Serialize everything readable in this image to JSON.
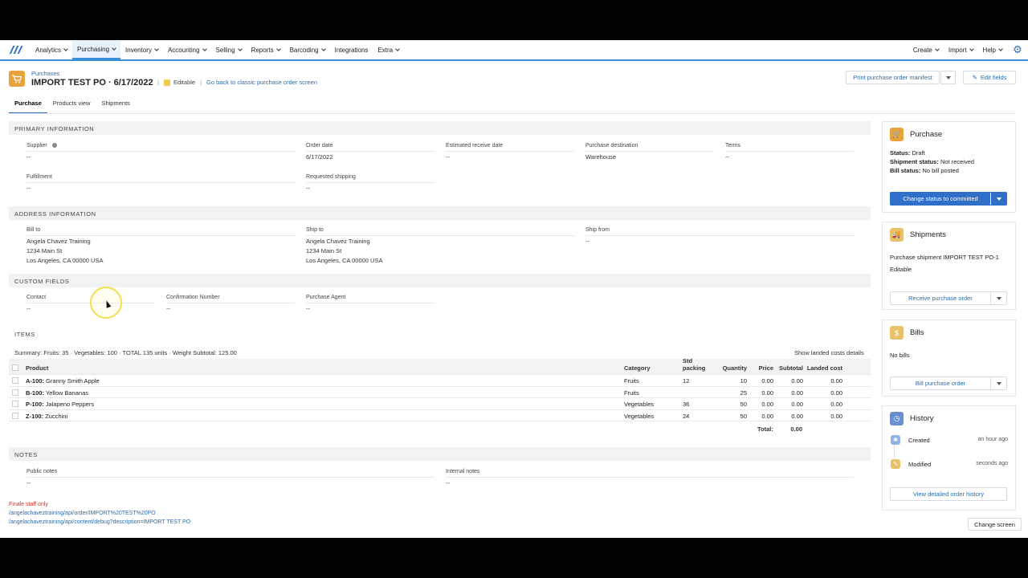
{
  "nav": {
    "items": [
      "Analytics",
      "Purchasing",
      "Inventory",
      "Accounting",
      "Selling",
      "Reports",
      "Barcoding",
      "Integrations",
      "Extra"
    ],
    "right_items": [
      "Create",
      "Import",
      "Help"
    ]
  },
  "header": {
    "breadcrumb": "Purchases",
    "title": "IMPORT TEST PO · 6/17/2022",
    "editable": "Editable",
    "classic_link": "Go back to classic purchase order screen",
    "print_manifest": "Print purchase order manifest",
    "edit_fields": "Edit fields"
  },
  "tabs": [
    "Purchase",
    "Products view",
    "Shipments"
  ],
  "primary": {
    "title": "PRIMARY INFORMATION",
    "supplier_label": "Supplier",
    "supplier_value": "--",
    "order_date_label": "Order date",
    "order_date_value": "6/17/2022",
    "est_receive_label": "Estimated receive date",
    "est_receive_value": "--",
    "destination_label": "Purchase destination",
    "destination_value": "Warehouse",
    "terms_label": "Terms",
    "terms_value": "--",
    "fulfillment_label": "Fulfillment",
    "fulfillment_value": "--",
    "req_shipping_label": "Requested shipping",
    "req_shipping_value": "--"
  },
  "address": {
    "title": "ADDRESS INFORMATION",
    "bill_to_label": "Bill to",
    "bill_to_lines": [
      "Angela Chavez Training",
      "1234 Main St",
      "Los Angeles, CA 00000 USA"
    ],
    "ship_to_label": "Ship to",
    "ship_to_lines": [
      "Angela Chavez Training",
      "1234 Main St",
      "Los Angeles, CA 00000 USA"
    ],
    "ship_from_label": "Ship from",
    "ship_from_value": "--"
  },
  "custom": {
    "title": "CUSTOM FIELDS",
    "contact_label": "Contact",
    "contact_value": "--",
    "confirmation_label": "Confirmation Number",
    "confirmation_value": "--",
    "agent_label": "Purchase Agent",
    "agent_value": "--"
  },
  "items": {
    "title": "ITEMS",
    "summary": "Summary: Fruits: 35 · Vegetables: 100 · TOTAL 135 units · Weight Subtotal: 125.00",
    "landed_link": "Show landed costs details",
    "columns": [
      "Product",
      "Category",
      "Std packing",
      "Quantity",
      "Price",
      "Subtotal",
      "Landed cost"
    ],
    "rows": [
      {
        "sku": "A-100:",
        "name": "Granny Smith Apple",
        "category": "Fruits",
        "std": "12",
        "qty": "10",
        "price": "0.00",
        "subtotal": "0.00",
        "landed": "0.00"
      },
      {
        "sku": "B-100:",
        "name": "Yellow Bananas",
        "category": "Fruits",
        "std": "",
        "qty": "25",
        "price": "0.00",
        "subtotal": "0.00",
        "landed": "0.00"
      },
      {
        "sku": "P-100:",
        "name": "Jalapeno Peppers",
        "category": "Vegetables",
        "std": "36",
        "qty": "50",
        "price": "0.00",
        "subtotal": "0.00",
        "landed": "0.00"
      },
      {
        "sku": "Z-100:",
        "name": "Zucchini",
        "category": "Vegetables",
        "std": "24",
        "qty": "50",
        "price": "0.00",
        "subtotal": "0.00",
        "landed": "0.00"
      }
    ],
    "total_label": "Total:",
    "total_value": "0.00"
  },
  "notes": {
    "title": "NOTES",
    "public_label": "Public notes",
    "public_value": "--",
    "internal_label": "Internal notes",
    "internal_value": "--"
  },
  "footer": {
    "staff": "Finale staff only",
    "link1": "/angelachaveztraining/api/order/IMPORT%20TEST%20PO",
    "link2": "/angelachaveztraining/api/content/debug?description=IMPORT TEST PO",
    "change_screen": "Change screen"
  },
  "sidebar": {
    "purchase": {
      "title": "Purchase",
      "status_label": "Status:",
      "status_value": "Draft",
      "shipment_label": "Shipment status:",
      "shipment_value": "Not received",
      "bill_label": "Bill status:",
      "bill_value": "No bill posted",
      "button": "Change status to committed"
    },
    "shipments": {
      "title": "Shipments",
      "link": "Purchase shipment IMPORT TEST PO-1",
      "status": "Editable",
      "button": "Receive purchase order"
    },
    "bills": {
      "title": "Bills",
      "text": "No bills",
      "button": "Bill purchase order"
    },
    "history": {
      "title": "History",
      "events": [
        {
          "label": "Created",
          "time": "an hour ago"
        },
        {
          "label": "Modified",
          "time": "seconds ago"
        }
      ],
      "button": "View detailed order history"
    }
  },
  "colors": {
    "accent": "#2f6fca",
    "brand": "#e8a33d",
    "link": "#2c6db0",
    "staff": "#d0302a"
  }
}
